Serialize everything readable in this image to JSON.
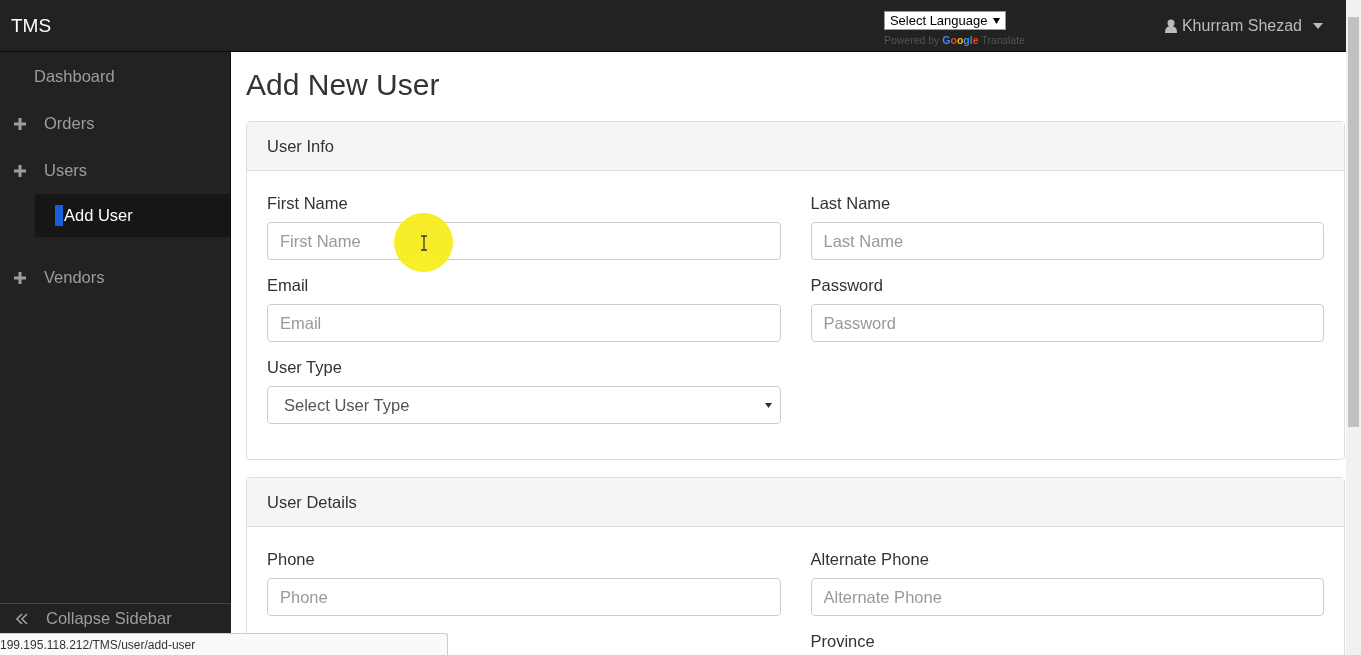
{
  "header": {
    "brand": "TMS",
    "language_select": "Select Language",
    "powered_by": "Powered by",
    "google": "Google",
    "translate": "Translate",
    "user": "Khurram Shezad"
  },
  "sidebar": {
    "items": [
      {
        "label": "Dashboard",
        "kind": "link",
        "selected": false
      },
      {
        "label": "Orders",
        "kind": "group",
        "selected": false
      },
      {
        "label": "Users",
        "kind": "group",
        "selected": false,
        "children": [
          {
            "label": "Add User",
            "selected": true
          }
        ]
      },
      {
        "label": "Vendors",
        "kind": "group",
        "selected": false
      }
    ],
    "collapse_label": "Collapse Sidebar"
  },
  "page": {
    "title": "Add New User",
    "panels": [
      {
        "title": "User Info",
        "fields": [
          {
            "label": "First Name",
            "kind": "text",
            "placeholder": "First Name"
          },
          {
            "label": "Last Name",
            "kind": "text",
            "placeholder": "Last Name"
          },
          {
            "label": "Email",
            "kind": "text",
            "placeholder": "Email"
          },
          {
            "label": "Password",
            "kind": "text",
            "placeholder": "Password"
          },
          {
            "label": "User Type",
            "kind": "select",
            "value": "Select User Type"
          }
        ]
      },
      {
        "title": "User Details",
        "fields": [
          {
            "label": "Phone",
            "kind": "text",
            "placeholder": "Phone"
          },
          {
            "label": "Alternate Phone",
            "kind": "text",
            "placeholder": "Alternate Phone"
          },
          {
            "label": "Province",
            "kind": "label"
          }
        ]
      }
    ]
  },
  "status_bar": {
    "url": "199.195.118.212/TMS/user/add-user"
  }
}
